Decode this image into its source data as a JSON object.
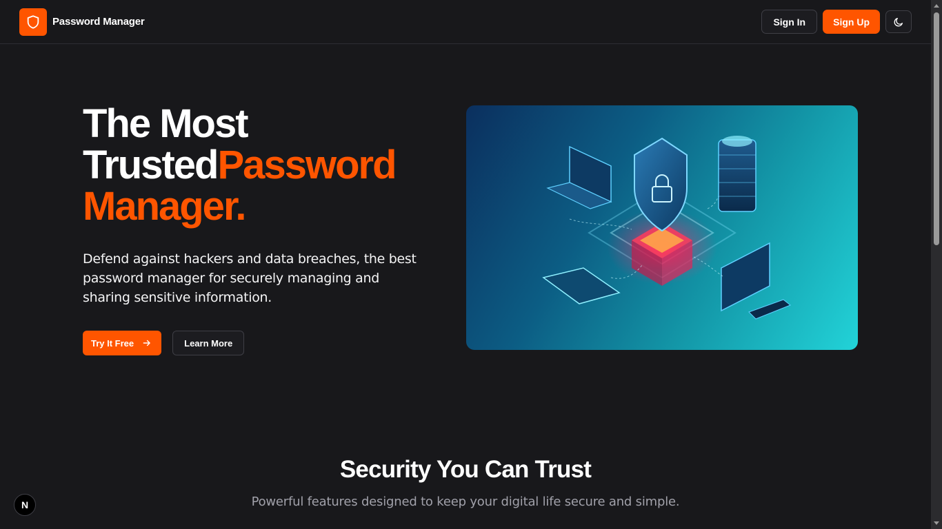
{
  "brand": {
    "name": "Password Manager",
    "logo_icon": "shield-icon",
    "color": "#ff5500"
  },
  "nav": {
    "sign_in": "Sign In",
    "sign_up": "Sign Up",
    "theme_toggle_icon": "moon-icon"
  },
  "hero": {
    "title_line1": "The Most",
    "title_line2_white": "Trusted",
    "title_line2_accent": "Password",
    "title_line3": "Manager.",
    "description": "Defend against hackers and data breaches, the best password manager for securely managing and sharing sensitive information.",
    "cta_primary": "Try It Free",
    "cta_primary_icon": "arrow-right-icon",
    "cta_secondary": "Learn More",
    "image_icon": "cybersecurity-illustration"
  },
  "features": {
    "title": "Security You Can Trust",
    "subtitle": "Powerful features designed to keep your digital life secure and simple."
  },
  "dev_badge": {
    "label": "N"
  },
  "colors": {
    "background": "#18181b",
    "accent": "#ff5500",
    "muted": "#a1a1aa"
  }
}
